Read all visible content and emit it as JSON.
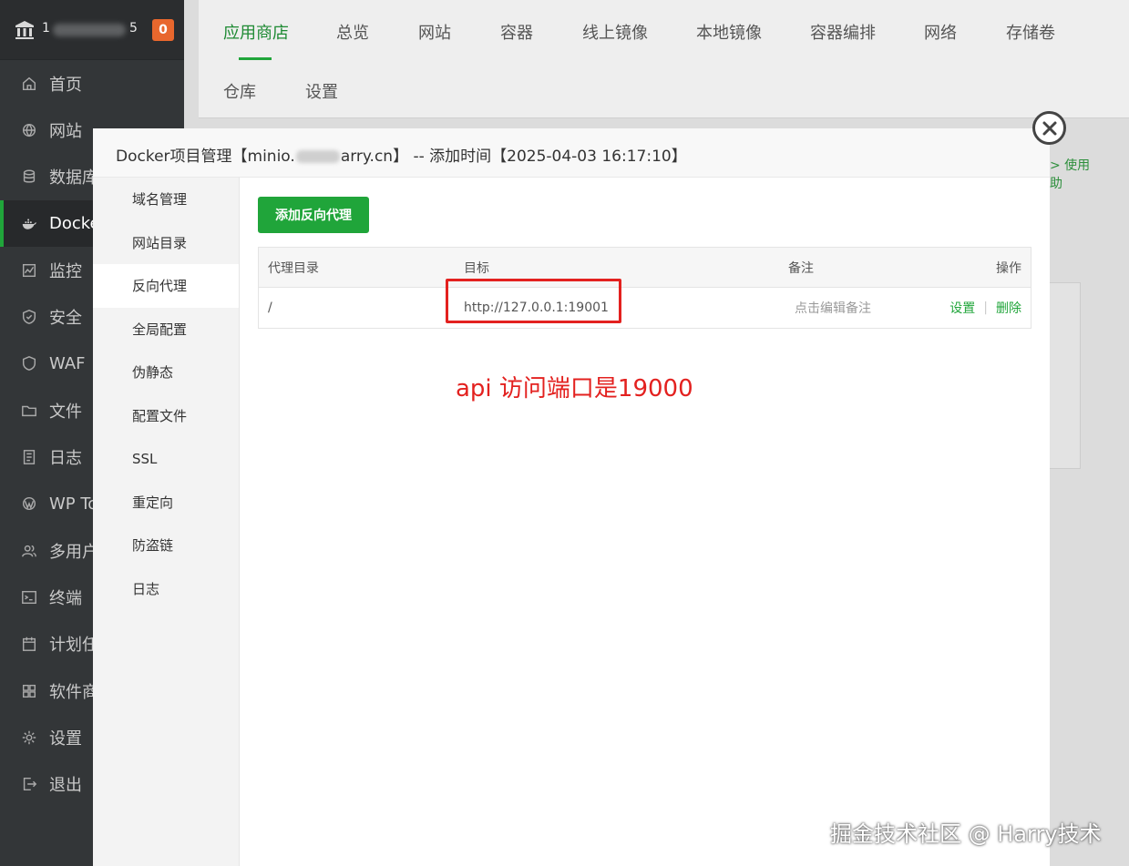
{
  "sidebar": {
    "logo_prefix": "1",
    "logo_suffix": "5",
    "badge": "0",
    "items": [
      {
        "label": "首页",
        "icon": "home-icon"
      },
      {
        "label": "网站",
        "icon": "globe-icon"
      },
      {
        "label": "数据库",
        "icon": "database-icon"
      },
      {
        "label": "Docker",
        "icon": "docker-icon"
      },
      {
        "label": "监控",
        "icon": "monitor-icon"
      },
      {
        "label": "安全",
        "icon": "shield-icon"
      },
      {
        "label": "WAF",
        "icon": "waf-shield-icon"
      },
      {
        "label": "文件",
        "icon": "folder-icon"
      },
      {
        "label": "日志",
        "icon": "log-icon"
      },
      {
        "label": "WP To",
        "icon": "wordpress-icon"
      },
      {
        "label": "多用户",
        "icon": "users-icon"
      },
      {
        "label": "终端",
        "icon": "terminal-icon"
      },
      {
        "label": "计划任",
        "icon": "calendar-icon"
      },
      {
        "label": "软件商",
        "icon": "apps-icon"
      },
      {
        "label": "设置",
        "icon": "gear-icon"
      },
      {
        "label": "退出",
        "icon": "logout-icon"
      }
    ],
    "active_index": 3
  },
  "topbar": {
    "tabs_row1": [
      "应用商店",
      "总览",
      "网站",
      "容器",
      "线上镜像",
      "本地镜像",
      "容器编排",
      "网络",
      "存储卷"
    ],
    "tabs_row2": [
      "仓库",
      "设置"
    ],
    "active": "应用商店"
  },
  "background_hint": {
    "line1": "> 使用",
    "line2": "助"
  },
  "modal": {
    "title_prefix": "Docker项目管理【minio.",
    "title_suffix": "arry.cn】 -- 添加时间【2025-04-03 16:17:10】",
    "side_menu": [
      "域名管理",
      "网站目录",
      "反向代理",
      "全局配置",
      "伪静态",
      "配置文件",
      "SSL",
      "重定向",
      "防盗链",
      "日志"
    ],
    "active_side": "反向代理",
    "add_button": "添加反向代理",
    "table": {
      "headers": [
        "代理目录",
        "目标",
        "备注",
        "操作"
      ],
      "rows": [
        {
          "dir": "/",
          "target": "http://127.0.0.1:19001",
          "note": "点击编辑备注",
          "op_set": "设置",
          "op_delete": "删除"
        }
      ]
    }
  },
  "annotation": "api 访问端口是19000",
  "watermark": "掘金技术社区 @ Harry技术",
  "colors": {
    "accent": "#20a53a",
    "sidebar_bg": "#333638",
    "annotation_red": "#e3211f",
    "badge": "#e8672d"
  }
}
